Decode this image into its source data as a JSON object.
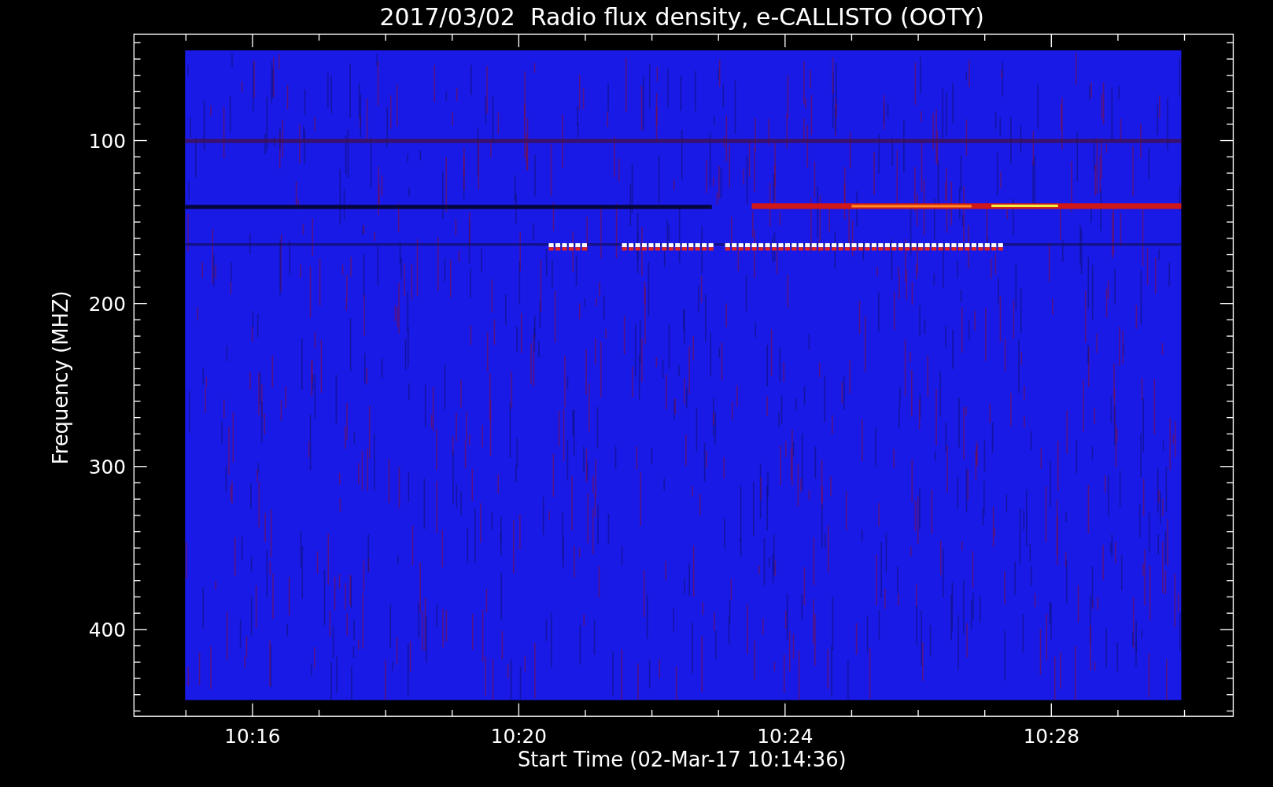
{
  "title": "2017/03/02  Radio flux density, e-CALLISTO (OOTY)",
  "y_axis": {
    "label": "Frequency (MHZ)",
    "ticks": [
      "100",
      "200",
      "300",
      "400"
    ]
  },
  "x_axis": {
    "label": "Start Time (02-Mar-17 10:14:36)",
    "ticks": [
      "10:16",
      "10:20",
      "10:24",
      "10:28"
    ]
  }
}
